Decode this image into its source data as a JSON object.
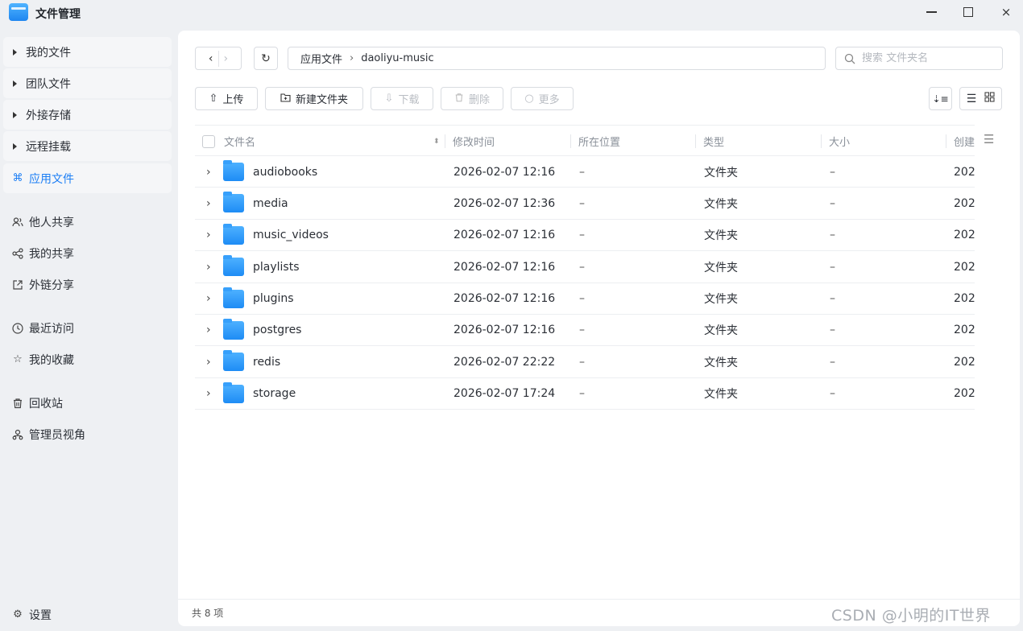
{
  "app": {
    "title": "文件管理"
  },
  "window_controls": {
    "minimize": "minimize-icon",
    "maximize": "maximize-icon",
    "close": "×"
  },
  "sidebar": {
    "items": [
      {
        "label": "我的文件",
        "icon": "triangle-right"
      },
      {
        "label": "团队文件",
        "icon": "triangle-right"
      },
      {
        "label": "外接存储",
        "icon": "triangle-right"
      },
      {
        "label": "远程挂载",
        "icon": "triangle-right"
      },
      {
        "label": "应用文件",
        "icon": "apps-icon"
      },
      {
        "label": "他人共享",
        "icon": "users-icon"
      },
      {
        "label": "我的共享",
        "icon": "share-icon"
      },
      {
        "label": "外链分享",
        "icon": "link-share-icon"
      },
      {
        "label": "最近访问",
        "icon": "clock-icon"
      },
      {
        "label": "我的收藏",
        "icon": "star-icon"
      },
      {
        "label": "回收站",
        "icon": "trash-icon"
      },
      {
        "label": "管理员视角",
        "icon": "admin-icon"
      },
      {
        "label": "设置",
        "icon": "gear-icon"
      }
    ]
  },
  "path": {
    "root": "应用文件",
    "current": "daoliyu-music"
  },
  "search": {
    "placeholder": "搜索 文件夹名"
  },
  "toolbar": {
    "upload": "上传",
    "new_folder": "新建文件夹",
    "download": "下载",
    "delete": "删除",
    "more": "更多"
  },
  "table": {
    "headers": {
      "name": "文件名",
      "modified": "修改时间",
      "location": "所在位置",
      "type": "类型",
      "size": "大小",
      "created": "创建"
    },
    "rows": [
      {
        "name": "audiobooks",
        "modified": "2026-02-07 12:16",
        "location": "–",
        "type": "文件夹",
        "size": "–",
        "created": "202"
      },
      {
        "name": "media",
        "modified": "2026-02-07 12:36",
        "location": "–",
        "type": "文件夹",
        "size": "–",
        "created": "202"
      },
      {
        "name": "music_videos",
        "modified": "2026-02-07 12:16",
        "location": "–",
        "type": "文件夹",
        "size": "–",
        "created": "202"
      },
      {
        "name": "playlists",
        "modified": "2026-02-07 12:16",
        "location": "–",
        "type": "文件夹",
        "size": "–",
        "created": "202"
      },
      {
        "name": "plugins",
        "modified": "2026-02-07 12:16",
        "location": "–",
        "type": "文件夹",
        "size": "–",
        "created": "202"
      },
      {
        "name": "postgres",
        "modified": "2026-02-07 12:16",
        "location": "–",
        "type": "文件夹",
        "size": "–",
        "created": "202"
      },
      {
        "name": "redis",
        "modified": "2026-02-07 22:22",
        "location": "–",
        "type": "文件夹",
        "size": "–",
        "created": "202"
      },
      {
        "name": "storage",
        "modified": "2026-02-07 17:24",
        "location": "–",
        "type": "文件夹",
        "size": "–",
        "created": "202"
      }
    ]
  },
  "status": {
    "count_text": "共 8 项"
  },
  "watermark": "CSDN @小明的IT世界",
  "colors": {
    "accent": "#1c7ef5",
    "folder": "#2a97f8",
    "panel_bg": "#ffffff",
    "app_bg": "#eef0f3"
  }
}
